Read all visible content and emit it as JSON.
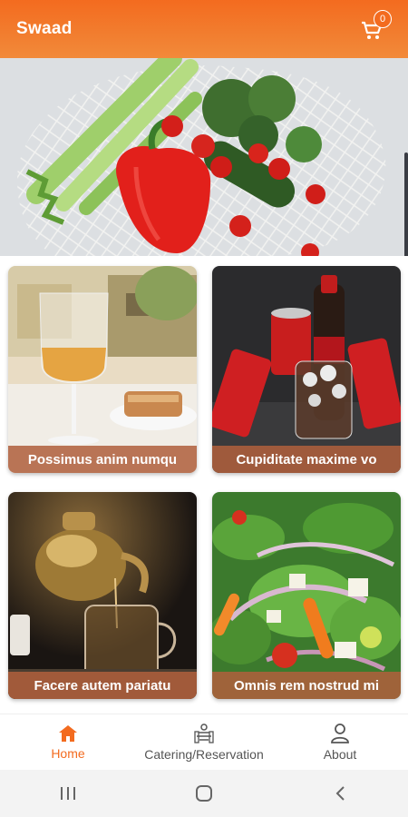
{
  "app": {
    "title": "Swaad"
  },
  "cart": {
    "count": "0",
    "icon": "cart-icon"
  },
  "colors": {
    "accent": "#f36b1f",
    "label_bg": "#b0603c"
  },
  "hero": {
    "image": "vegetables-in-net-bag",
    "page_index": 1,
    "page_count": 2
  },
  "cards": [
    {
      "title": "Possimus anim numqu",
      "image": "glass-of-wine-with-snack"
    },
    {
      "title": "Cupiditate maxime vo",
      "image": "cola-bottles-and-cans"
    },
    {
      "title": "Facere autem pariatu",
      "image": "teapot-pouring-tea"
    },
    {
      "title": "Omnis rem nostrud mi",
      "image": "fresh-salad"
    }
  ],
  "nav": {
    "items": [
      {
        "label": "Home",
        "icon": "home-icon",
        "active": true
      },
      {
        "label": "Catering/Reservation",
        "icon": "catering-icon",
        "active": false
      },
      {
        "label": "About",
        "icon": "person-icon",
        "active": false
      }
    ]
  },
  "system_nav": {
    "recents": "recents-icon",
    "home": "home-circle-icon",
    "back": "back-icon"
  }
}
